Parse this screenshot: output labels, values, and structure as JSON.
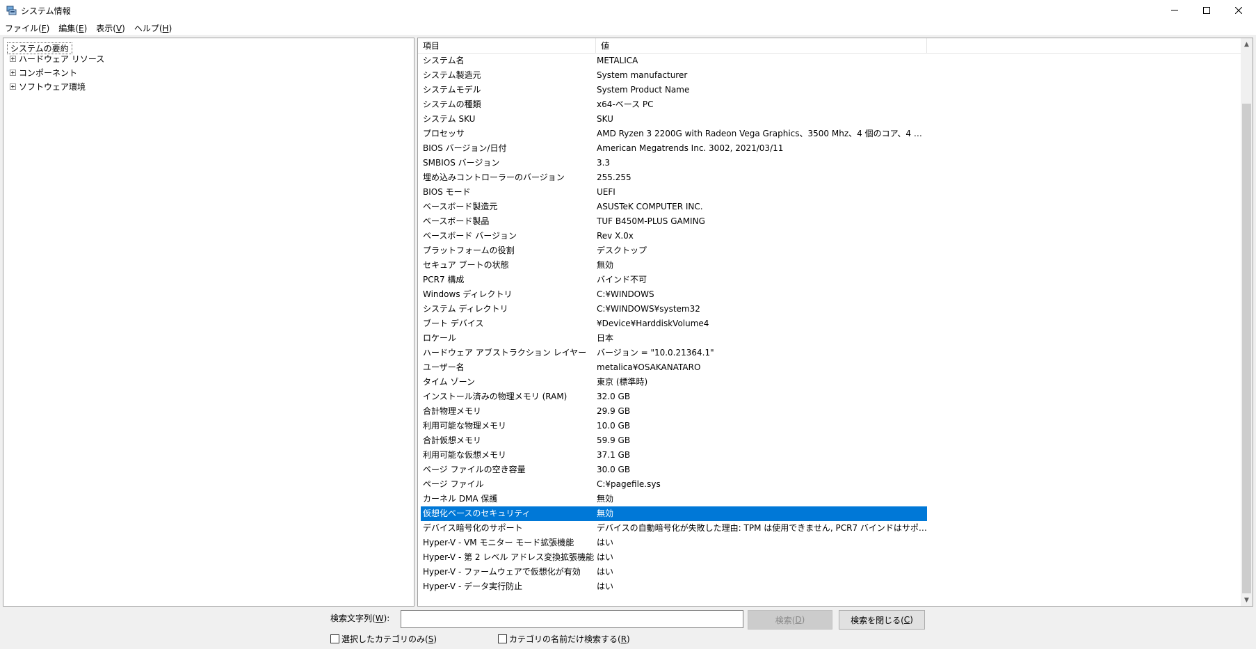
{
  "window": {
    "title": "システム情報",
    "min_icon": "minimize-icon",
    "max_icon": "maximize-icon",
    "close_icon": "close-icon"
  },
  "menu": [
    {
      "label": "ファイル(",
      "acc": "F",
      "tail": ")"
    },
    {
      "label": "編集(",
      "acc": "E",
      "tail": ")"
    },
    {
      "label": "表示(",
      "acc": "V",
      "tail": ")"
    },
    {
      "label": "ヘルプ(",
      "acc": "H",
      "tail": ")"
    }
  ],
  "tree": {
    "root": "システムの要約",
    "children": [
      "ハードウェア リソース",
      "コンポーネント",
      "ソフトウェア環境"
    ]
  },
  "list": {
    "col_item": "項目",
    "col_value": "値",
    "selected_index": 31,
    "rows": [
      [
        "システム名",
        "METALICA"
      ],
      [
        "システム製造元",
        "System manufacturer"
      ],
      [
        "システムモデル",
        "System Product Name"
      ],
      [
        "システムの種類",
        "x64-ベース PC"
      ],
      [
        "システム SKU",
        "SKU"
      ],
      [
        "プロセッサ",
        "AMD Ryzen 3 2200G with Radeon Vega Graphics、3500 Mhz、4 個のコア、4 個..."
      ],
      [
        "BIOS バージョン/日付",
        "American Megatrends Inc. 3002, 2021/03/11"
      ],
      [
        "SMBIOS バージョン",
        "3.3"
      ],
      [
        "埋め込みコントローラーのバージョン",
        "255.255"
      ],
      [
        "BIOS モード",
        "UEFI"
      ],
      [
        "ベースボード製造元",
        "ASUSTeK COMPUTER INC."
      ],
      [
        "ベースボード製品",
        "TUF B450M-PLUS GAMING"
      ],
      [
        "ベースボード バージョン",
        "Rev X.0x"
      ],
      [
        "プラットフォームの役割",
        "デスクトップ"
      ],
      [
        "セキュア ブートの状態",
        "無効"
      ],
      [
        "PCR7 構成",
        "バインド不可"
      ],
      [
        "Windows ディレクトリ",
        "C:¥WINDOWS"
      ],
      [
        "システム ディレクトリ",
        "C:¥WINDOWS¥system32"
      ],
      [
        "ブート デバイス",
        "¥Device¥HarddiskVolume4"
      ],
      [
        "ロケール",
        "日本"
      ],
      [
        "ハードウェア アブストラクション レイヤー",
        "バージョン = \"10.0.21364.1\""
      ],
      [
        "ユーザー名",
        "metalica¥OSAKANATARO"
      ],
      [
        "タイム ゾーン",
        "東京 (標準時)"
      ],
      [
        "インストール済みの物理メモリ (RAM)",
        "32.0 GB"
      ],
      [
        "合計物理メモリ",
        "29.9 GB"
      ],
      [
        "利用可能な物理メモリ",
        "10.0 GB"
      ],
      [
        "合計仮想メモリ",
        "59.9 GB"
      ],
      [
        "利用可能な仮想メモリ",
        "37.1 GB"
      ],
      [
        "ページ ファイルの空き容量",
        "30.0 GB"
      ],
      [
        "ページ ファイル",
        "C:¥pagefile.sys"
      ],
      [
        "カーネル DMA 保護",
        "無効"
      ],
      [
        "仮想化ベースのセキュリティ",
        "無効"
      ],
      [
        "デバイス暗号化のサポート",
        "デバイスの自動暗号化が失敗した理由: TPM は使用できません, PCR7 バインドはサポート..."
      ],
      [
        "Hyper-V - VM モニター モード拡張機能",
        "はい"
      ],
      [
        "Hyper-V - 第 2 レベル アドレス変換拡張機能",
        "はい"
      ],
      [
        "Hyper-V - ファームウェアで仮想化が有効",
        "はい"
      ],
      [
        "Hyper-V - データ実行防止",
        "はい"
      ]
    ]
  },
  "search": {
    "label": "検索文字列(",
    "label_acc": "W",
    "label_tail": "):",
    "value": "",
    "find_label": "検索(",
    "find_acc": "D",
    "find_tail": ")",
    "close_label": "検索を閉じる(",
    "close_acc": "C",
    "close_tail": ")",
    "chk_selected": "選択したカテゴリのみ(",
    "chk_selected_acc": "S",
    "chk_selected_tail": ")",
    "chk_names": "カテゴリの名前だけ検索する(",
    "chk_names_acc": "R",
    "chk_names_tail": ")"
  }
}
